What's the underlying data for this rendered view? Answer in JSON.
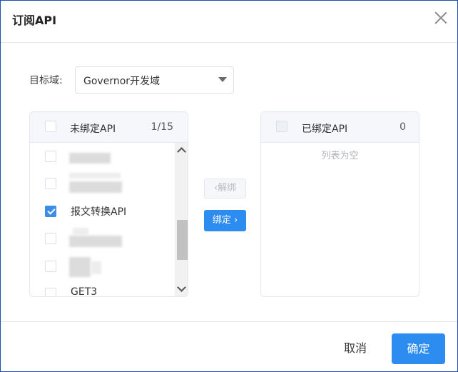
{
  "dialog": {
    "title": "订阅API",
    "close_icon": "close-icon"
  },
  "domain": {
    "label": "目标域:",
    "selected": "Governor开发域"
  },
  "unbound": {
    "title": "未绑定API",
    "count": "1/15",
    "items": [
      {
        "label": "",
        "checked": false
      },
      {
        "label": "",
        "checked": false
      },
      {
        "label": "报文转换API",
        "checked": true
      },
      {
        "label": "",
        "checked": false
      },
      {
        "label": "",
        "checked": false
      },
      {
        "label": "GET3",
        "checked": false
      }
    ]
  },
  "bound": {
    "title": "已绑定API",
    "count": "0",
    "empty_text": "列表为空"
  },
  "transfer": {
    "unbind_label": "解绑",
    "bind_label": "绑定",
    "unbind_icon": "chevron-left-icon",
    "bind_icon": "chevron-right-icon"
  },
  "footer": {
    "cancel_label": "取消",
    "confirm_label": "确定"
  },
  "colors": {
    "primary": "#2d8cf0",
    "check": "#3a8ee6",
    "border": "#dcdfe6"
  }
}
